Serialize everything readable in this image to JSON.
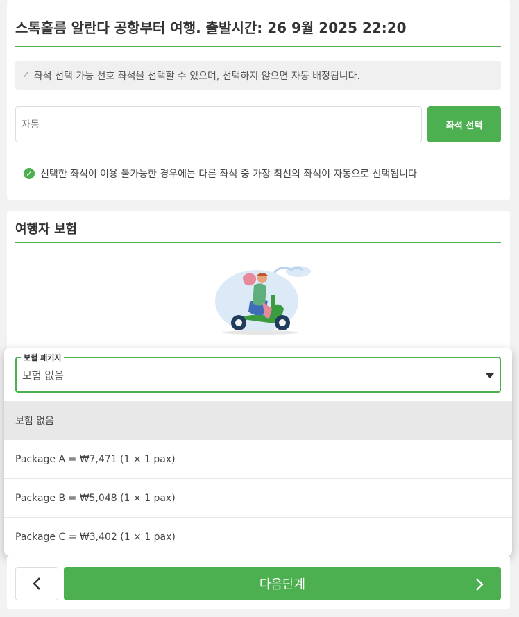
{
  "seat_section": {
    "title": "스톡홀름 알란다 공항부터 여행. 출발시간: 26 9월 2025 22:20",
    "notice": "좌석 선택 가능 선호 좌석을 선택할 수 있으며, 선택하지 않으면 자동 배정됩니다.",
    "seat_input_value": "자동",
    "select_seat_button": "좌석 선택",
    "auto_assign_note": "선택한 좌석이 이용 불가능한 경우에는 다른 좌석 중 가장 최선의 좌석이 자동으로 선택됩니다"
  },
  "insurance_section": {
    "title": "여행자 보험",
    "package_label": "보험 패키지",
    "selected_value": "보험 없음",
    "options": [
      "보험 없음",
      "Package A = ₩7,471 (1 × 1 pax)",
      "Package B = ₩5,048 (1 × 1 pax)",
      "Package C = ₩3,402 (1 × 1 pax)"
    ]
  },
  "navigation": {
    "next_button": "다음단계"
  },
  "colors": {
    "accent": "#4caf50",
    "background": "#f2f2f2"
  }
}
